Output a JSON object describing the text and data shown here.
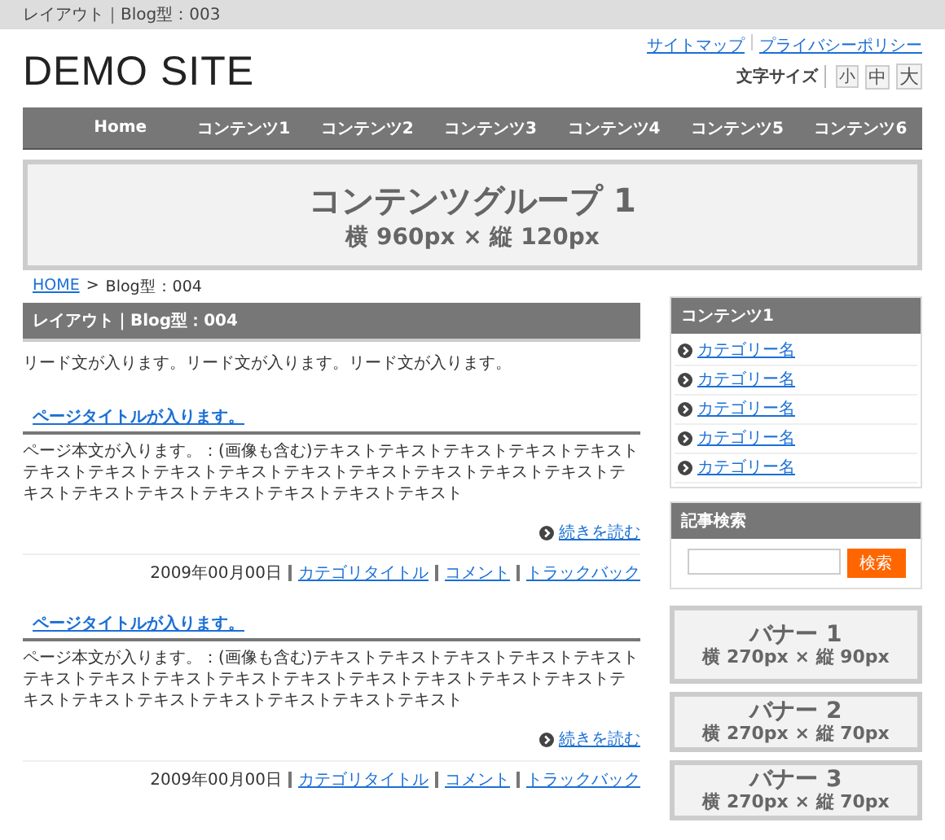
{
  "top_bar": {
    "text": "レイアウト｜Blog型：003"
  },
  "header": {
    "logo": "DEMO SITE",
    "links": [
      "サイトマップ",
      "プライバシーポリシー"
    ],
    "font_size_label": "文字サイズ",
    "font_size_buttons": [
      "小",
      "中",
      "大"
    ]
  },
  "nav": [
    "Home",
    "コンテンツ1",
    "コンテンツ2",
    "コンテンツ3",
    "コンテンツ4",
    "コンテンツ5",
    "コンテンツ6"
  ],
  "hero": {
    "title": "コンテンツグループ 1",
    "size": "横 960px × 縦 120px"
  },
  "breadcrumb": {
    "home": "HOME",
    "separator": ">",
    "current": "Blog型：004"
  },
  "main": {
    "heading": "レイアウト｜Blog型：004",
    "lead": "リード文が入ります。リード文が入ります。リード文が入ります。",
    "posts": [
      {
        "title": "ページタイトルが入ります。",
        "body": "ページ本文が入ります。：(画像も含む)テキストテキストテキストテキストテキストテキストテキストテキストテキストテキストテキストテキストテキストテキストテキストテキストテキストテキストテキストテキストテキスト",
        "more": "続きを読む",
        "date": "2009年00月00日",
        "links": [
          "カテゴリタイトル",
          "コメント",
          "トラックバック"
        ]
      },
      {
        "title": "ページタイトルが入ります。",
        "body": "ページ本文が入ります。：(画像も含む)テキストテキストテキストテキストテキストテキストテキストテキストテキストテキストテキストテキストテキストテキストテキストテキストテキストテキストテキストテキストテキスト",
        "more": "続きを読む",
        "date": "2009年00月00日",
        "links": [
          "カテゴリタイトル",
          "コメント",
          "トラックバック"
        ]
      }
    ]
  },
  "sidebar": {
    "menu": {
      "title": "コンテンツ1",
      "items": [
        "カテゴリー名",
        "カテゴリー名",
        "カテゴリー名",
        "カテゴリー名",
        "カテゴリー名"
      ]
    },
    "search": {
      "title": "記事検索",
      "button": "検索"
    },
    "banners": [
      {
        "title": "バナー 1",
        "size": "横 270px × 縦 90px"
      },
      {
        "title": "バナー 2",
        "size": "横 270px × 縦 70px"
      },
      {
        "title": "バナー 3",
        "size": "横 270px × 縦 70px"
      }
    ]
  }
}
